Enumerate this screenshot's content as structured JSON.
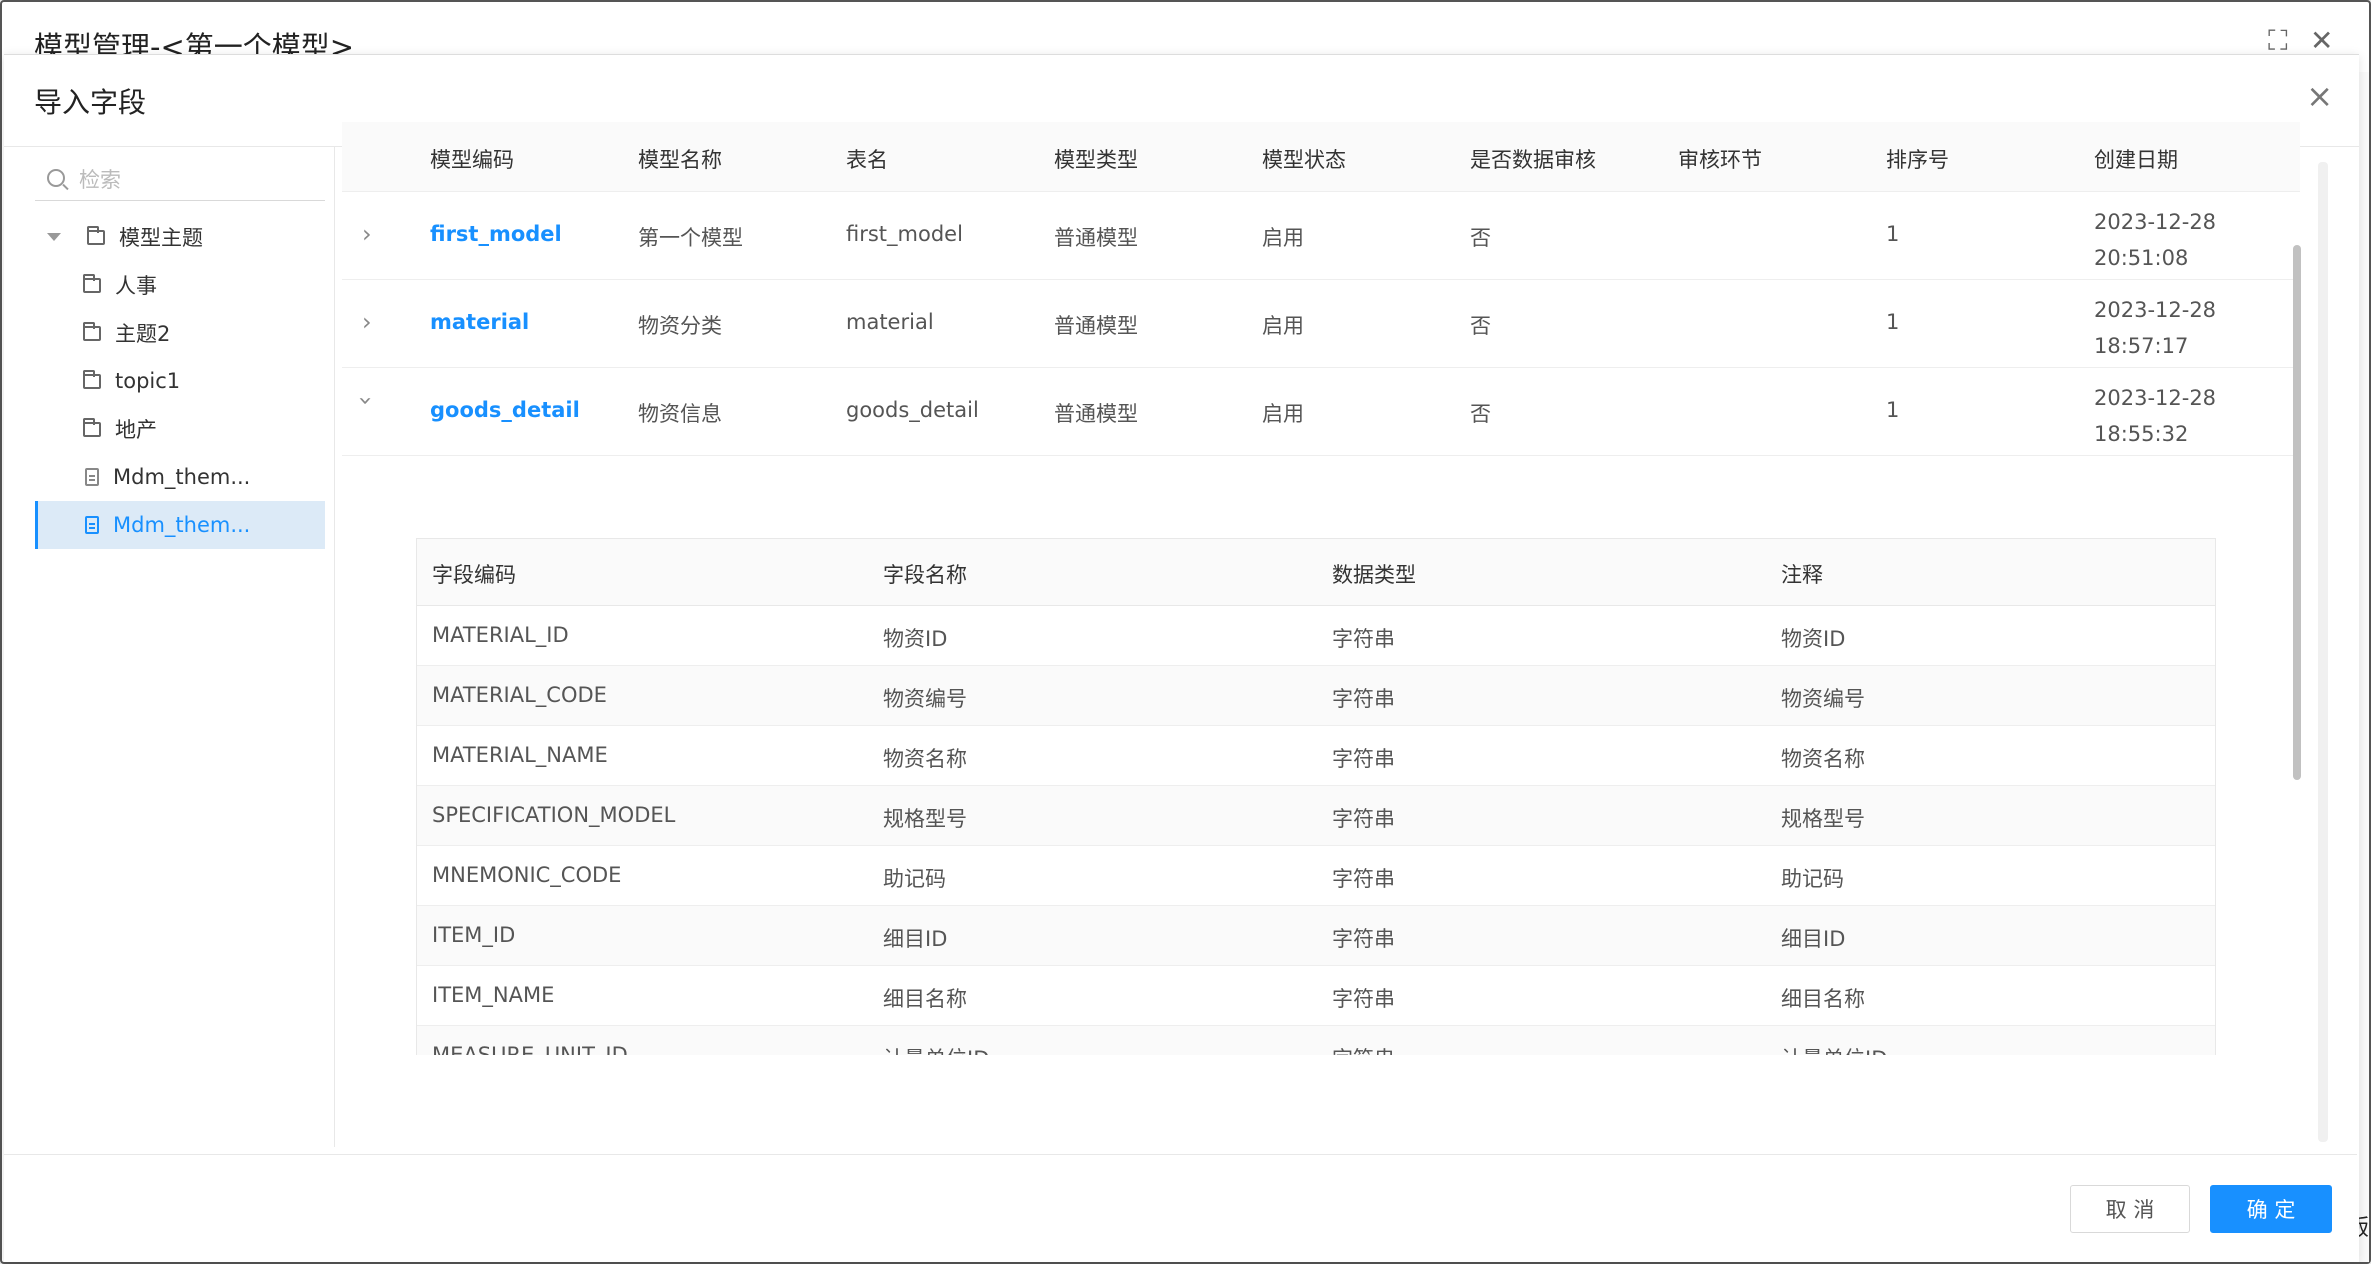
{
  "outer": {
    "title": "模型管理-<第一个模型>",
    "edge_char": "版"
  },
  "dialog": {
    "title": "导入字段",
    "close": "×"
  },
  "tree": {
    "search_placeholder": "检索",
    "root": "模型主题",
    "items": [
      {
        "label": "人事",
        "type": "folder"
      },
      {
        "label": "主题2",
        "type": "folder"
      },
      {
        "label": "topic1",
        "type": "folder"
      },
      {
        "label": "地产",
        "type": "folder"
      },
      {
        "label": "Mdm_them...",
        "type": "file"
      },
      {
        "label": "Mdm_them...",
        "type": "file",
        "selected": true
      }
    ]
  },
  "table": {
    "headers": [
      "模型编码",
      "模型名称",
      "表名",
      "模型类型",
      "模型状态",
      "是否数据审核",
      "审核环节",
      "排序号",
      "创建日期"
    ],
    "rows": [
      {
        "code": "first_model",
        "name": "第一个模型",
        "table": "first_model",
        "type": "普通模型",
        "status": "启用",
        "audit": "否",
        "audit_step": "",
        "order": "1",
        "date": "2023-12-28 20:51:08",
        "expanded": false
      },
      {
        "code": "material",
        "name": "物资分类",
        "table": "material",
        "type": "普通模型",
        "status": "启用",
        "audit": "否",
        "audit_step": "",
        "order": "1",
        "date": "2023-12-28 18:57:17",
        "expanded": false
      },
      {
        "code": "goods_detail",
        "name": "物资信息",
        "table": "goods_detail",
        "type": "普通模型",
        "status": "启用",
        "audit": "否",
        "audit_step": "",
        "order": "1",
        "date": "2023-12-28 18:55:32",
        "expanded": true
      }
    ]
  },
  "fields": {
    "headers": [
      "字段编码",
      "字段名称",
      "数据类型",
      "注释"
    ],
    "rows": [
      [
        "MATERIAL_ID",
        "物资ID",
        "字符串",
        "物资ID"
      ],
      [
        "MATERIAL_CODE",
        "物资编号",
        "字符串",
        "物资编号"
      ],
      [
        "MATERIAL_NAME",
        "物资名称",
        "字符串",
        "物资名称"
      ],
      [
        "SPECIFICATION_MODEL",
        "规格型号",
        "字符串",
        "规格型号"
      ],
      [
        "MNEMONIC_CODE",
        "助记码",
        "字符串",
        "助记码"
      ],
      [
        "ITEM_ID",
        "细目ID",
        "字符串",
        "细目ID"
      ],
      [
        "ITEM_NAME",
        "细目名称",
        "字符串",
        "细目名称"
      ],
      [
        "MEASURE_UNIT_ID",
        "计量单位ID",
        "字符串",
        "计量单位ID"
      ]
    ]
  },
  "footer": {
    "cancel": "取 消",
    "ok": "确 定"
  },
  "colors": {
    "accent": "#1890ff",
    "selected_bg": "#dceaf7"
  }
}
